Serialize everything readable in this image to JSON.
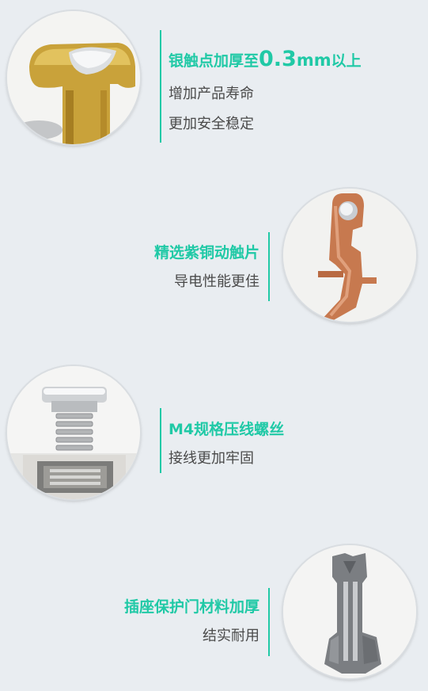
{
  "features": [
    {
      "headline_prefix": "银触点加厚至",
      "headline_number": "0.3",
      "headline_unit": "mm",
      "headline_suffix": "以上",
      "lines": [
        "增加产品寿命",
        "更加安全稳定"
      ],
      "icon": "silver-contact-icon"
    },
    {
      "headline": "精选紫铜动触片",
      "lines": [
        "导电性能更佳"
      ],
      "icon": "copper-contact-icon"
    },
    {
      "headline": "M4规格压线螺丝",
      "lines": [
        "接线更加牢固"
      ],
      "icon": "screw-icon"
    },
    {
      "headline": "插座保护门材料加厚",
      "lines": [
        "结实耐用"
      ],
      "icon": "shutter-part-icon"
    }
  ],
  "colors": {
    "accent": "#20c9a6",
    "background": "#e9edf1",
    "text": "#4a4a4a"
  }
}
